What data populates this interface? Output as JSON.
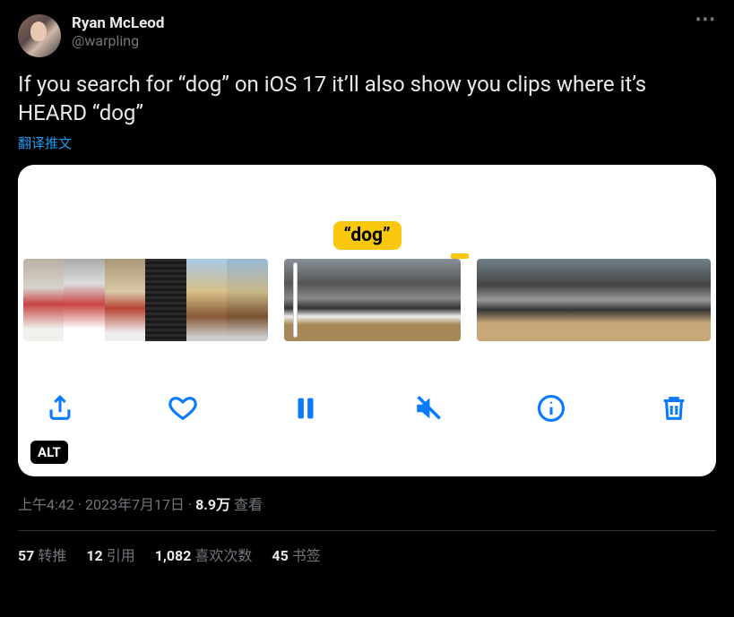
{
  "author": {
    "display_name": "Ryan McLeod",
    "handle": "@warpling"
  },
  "tweet_text": "If you search for “dog” on iOS 17 it’ll also show you clips where it’s HEARD “dog”",
  "translate_label": "翻译推文",
  "media": {
    "caption": "“dog”",
    "alt_badge": "ALT",
    "toolbar_icons": [
      "share",
      "heart",
      "pause",
      "mute",
      "info",
      "trash"
    ]
  },
  "meta": {
    "time": "上午4:42",
    "date": "2023年7月17日",
    "separator": " · ",
    "views_count": "8.9万",
    "views_label": " 查看"
  },
  "stats": {
    "retweets": {
      "count": "57",
      "label": "转推"
    },
    "quotes": {
      "count": "12",
      "label": "引用"
    },
    "likes": {
      "count": "1,082",
      "label": "喜欢次数"
    },
    "bookmarks": {
      "count": "45",
      "label": "书签"
    }
  }
}
